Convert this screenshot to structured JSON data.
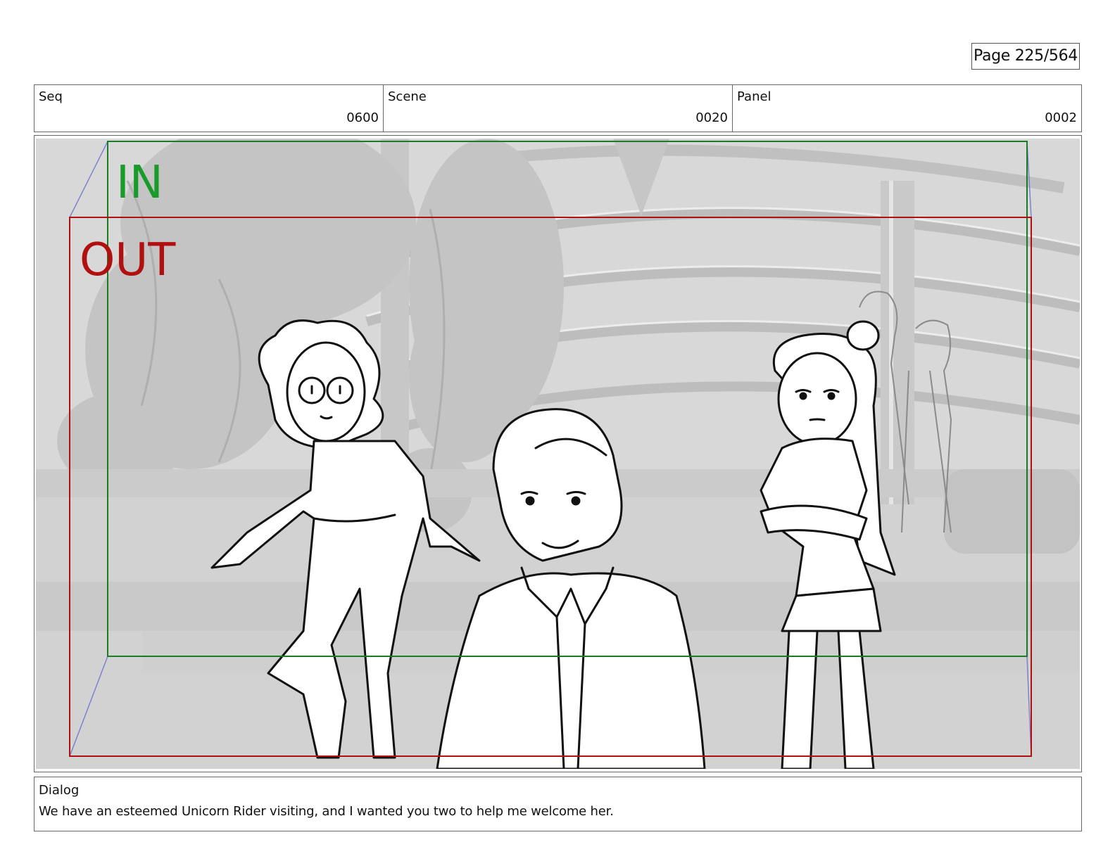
{
  "page": {
    "label": "Page 225/564"
  },
  "header": {
    "seq": {
      "label": "Seq",
      "value": "0600"
    },
    "scene": {
      "label": "Scene",
      "value": "0020"
    },
    "panel": {
      "label": "Panel",
      "value": "0002"
    }
  },
  "frame": {
    "in_label": "IN",
    "out_label": "OUT",
    "in_color": "#1a8a2a",
    "out_color": "#b01010"
  },
  "dialog": {
    "label": "Dialog",
    "text": "We have an esteemed Unicorn Rider visiting, and I wanted you two to help me welcome her."
  }
}
